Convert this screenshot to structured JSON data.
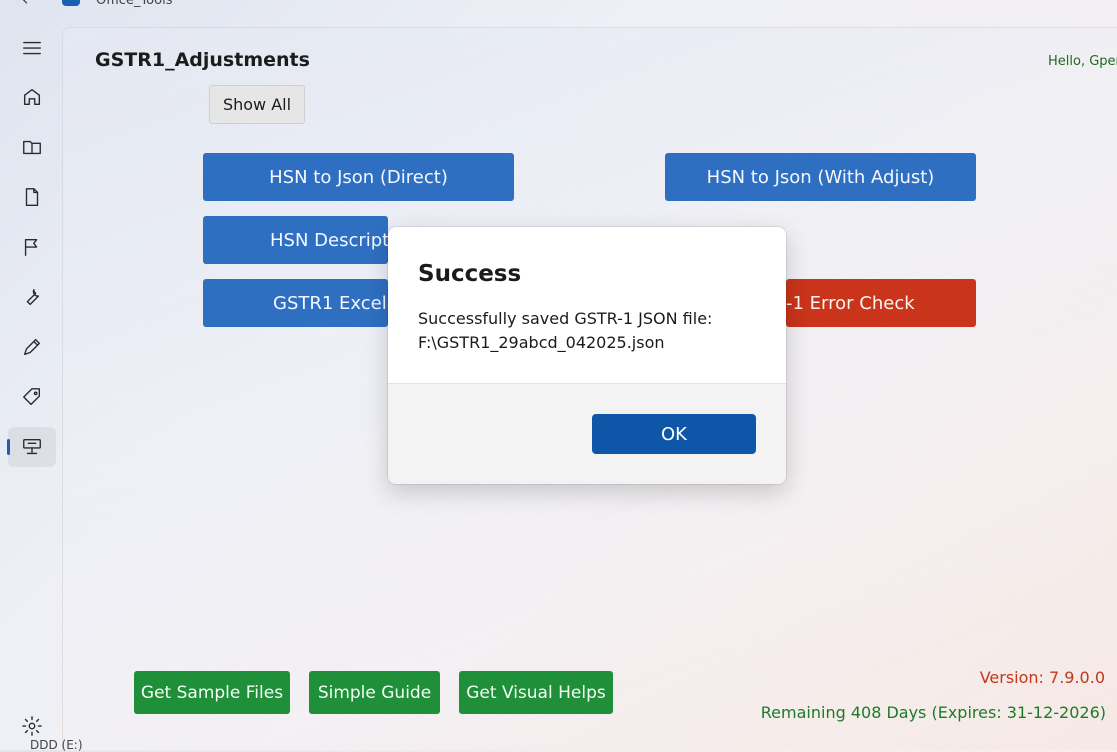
{
  "titlebar": {
    "app_title": "Office_Tools"
  },
  "header": {
    "title": "GSTR1_Adjustments",
    "greeting": "Hello, Gpen"
  },
  "buttons": {
    "show_all": "Show All",
    "hsn_direct": "HSN to Json (Direct)",
    "hsn_adjust": "HSN to Json (With Adjust)",
    "hsn_description": "HSN Descript",
    "gstr1_excel": "GSTR1 Excel t",
    "error_check": "-1 Error Check"
  },
  "footer_buttons": {
    "sample_files": "Get Sample Files",
    "simple_guide": "Simple Guide",
    "visual_helps": "Get Visual Helps"
  },
  "status": {
    "version": "Version: 7.9.0.0",
    "remaining": "Remaining 408 Days (Expires: 31-12-2026)"
  },
  "dialog": {
    "title": "Success",
    "message_line1": "Successfully saved GSTR-1 JSON file:",
    "message_line2": "F:\\GSTR1_29abcd_042025.json",
    "ok": "OK"
  },
  "bottom_strip": {
    "text": "DDD (E:)"
  },
  "colors": {
    "accent_blue": "#2e6fc2",
    "dialog_button": "#0e56a8",
    "error_red": "#c9341a",
    "success_green": "#1f8f3a"
  },
  "nav_icons": [
    "menu-icon",
    "home-icon",
    "book-icon",
    "document-icon",
    "flag-icon",
    "wrench-icon",
    "pencil-icon",
    "tag-icon",
    "tools-icon",
    "settings-icon"
  ]
}
